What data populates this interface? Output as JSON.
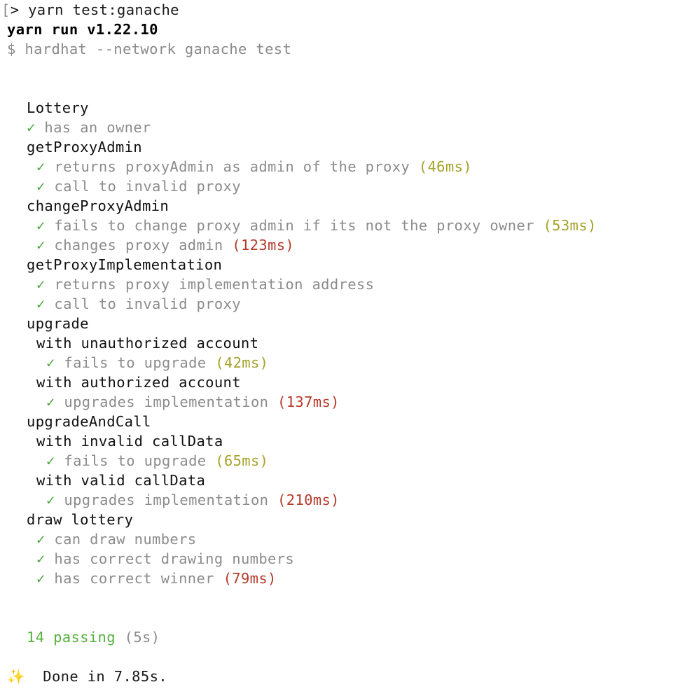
{
  "terminal": {
    "prompt_bracket": "[",
    "prompt_cmd": "> yarn test:ganache",
    "yarn_version": "yarn run v1.22.10",
    "subcommand": "$ hardhat --network ganache test",
    "check_glyph": "✓",
    "suite_root": "Lottery",
    "lines": [
      {
        "kind": "test",
        "indent": 2,
        "text": "has an owner"
      },
      {
        "kind": "suite",
        "indent": 2,
        "text": "getProxyAdmin"
      },
      {
        "kind": "test",
        "indent": 3,
        "text": "returns proxyAdmin as admin of the proxy",
        "time": "(46ms)",
        "speed": "medium"
      },
      {
        "kind": "test",
        "indent": 3,
        "text": "call to invalid proxy"
      },
      {
        "kind": "suite",
        "indent": 2,
        "text": "changeProxyAdmin"
      },
      {
        "kind": "test",
        "indent": 3,
        "text": "fails to change proxy admin if its not the proxy owner",
        "time": "(53ms)",
        "speed": "medium"
      },
      {
        "kind": "test",
        "indent": 3,
        "text": "changes proxy admin",
        "time": "(123ms)",
        "speed": "slow"
      },
      {
        "kind": "suite",
        "indent": 2,
        "text": "getProxyImplementation"
      },
      {
        "kind": "test",
        "indent": 3,
        "text": "returns proxy implementation address"
      },
      {
        "kind": "test",
        "indent": 3,
        "text": "call to invalid proxy"
      },
      {
        "kind": "suite",
        "indent": 2,
        "text": "upgrade"
      },
      {
        "kind": "suite",
        "indent": 3,
        "text": "with unauthorized account"
      },
      {
        "kind": "test",
        "indent": 4,
        "text": "fails to upgrade",
        "time": "(42ms)",
        "speed": "medium"
      },
      {
        "kind": "suite",
        "indent": 3,
        "text": "with authorized account"
      },
      {
        "kind": "test",
        "indent": 4,
        "text": "upgrades implementation",
        "time": "(137ms)",
        "speed": "slow"
      },
      {
        "kind": "suite",
        "indent": 2,
        "text": "upgradeAndCall"
      },
      {
        "kind": "suite",
        "indent": 3,
        "text": "with invalid callData"
      },
      {
        "kind": "test",
        "indent": 4,
        "text": "fails to upgrade",
        "time": "(65ms)",
        "speed": "medium"
      },
      {
        "kind": "suite",
        "indent": 3,
        "text": "with valid callData"
      },
      {
        "kind": "test",
        "indent": 4,
        "text": "upgrades implementation",
        "time": "(210ms)",
        "speed": "slow"
      },
      {
        "kind": "suite",
        "indent": 2,
        "text": "draw lottery"
      },
      {
        "kind": "test",
        "indent": 3,
        "text": "can draw numbers"
      },
      {
        "kind": "test",
        "indent": 3,
        "text": "has correct drawing numbers"
      },
      {
        "kind": "test",
        "indent": 3,
        "text": "has correct winner",
        "time": "(79ms)",
        "speed": "slow"
      }
    ],
    "summary_passing": "14 passing",
    "summary_time": "(5s)",
    "done_icon": "✨",
    "done_text": "Done in 7.85s.",
    "colors": {
      "check": "#4aa63b",
      "medium_time": "#a6a22a",
      "slow_time": "#b53a2a",
      "passing": "#56b13d"
    }
  }
}
